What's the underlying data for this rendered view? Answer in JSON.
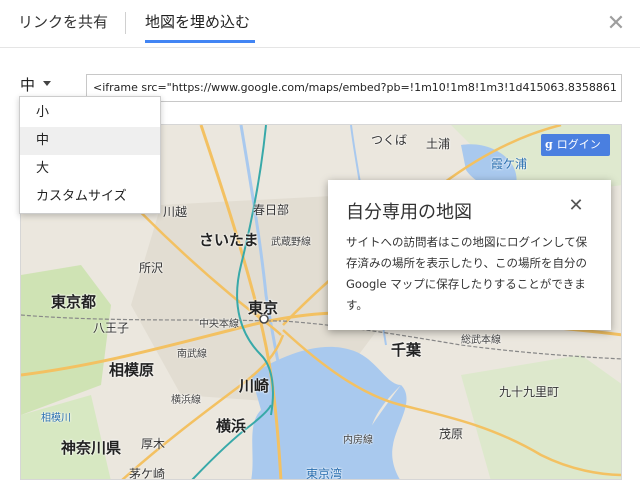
{
  "tabs": [
    {
      "label": "リンクを共有",
      "active": false
    },
    {
      "label": "地図を埋め込む",
      "active": true
    }
  ],
  "size_select": {
    "selected": "中",
    "options": [
      "小",
      "中",
      "大",
      "カスタムサイズ"
    ]
  },
  "embed_code": "<iframe src=\"https://www.google.com/maps/embed?pb=!1m10!1m8!1m3!1d415063.8358861",
  "login_button": {
    "g": "g",
    "label": "ログイン"
  },
  "info_card": {
    "title": "自分専用の地図",
    "body": "サイトへの訪問者はこの地図にログインして保存済みの場所を表示したり、この場所を自分の Google マップに保存したりすることができます。"
  },
  "map_labels": {
    "saitama": "さいたま",
    "tokyo": "東京",
    "tokyo_to": "東京都",
    "chiba": "千葉",
    "sagamihara": "相模原",
    "kawasaki": "川崎",
    "yokohama": "横浜",
    "kanagawa": "神奈川県",
    "tsukuba": "つくば",
    "tsuchiura": "土浦",
    "kasukabe": "春日部",
    "kawagoe": "川越",
    "tokorozawa": "所沢",
    "hachioji": "八王子",
    "musashino": "武蔵野線",
    "chuo": "中央本線",
    "nanbu": "南武線",
    "yokohama_line": "横浜線",
    "sobu": "総武本線",
    "uchibo": "内房線",
    "mobara": "茂原",
    "kujukuri": "九十九里町",
    "kasumigaura": "霞ケ浦",
    "tokyo_bay": "東京湾",
    "sagami_r": "相模川",
    "atsugi": "厚木",
    "chigasaki": "茅ケ崎"
  }
}
